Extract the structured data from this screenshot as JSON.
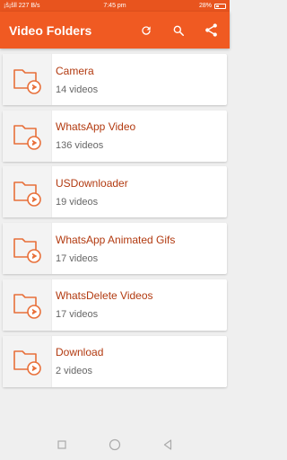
{
  "status_bar": {
    "left": "¡š¡šll 227 B/s",
    "time": "7:45 pm",
    "battery": "28%"
  },
  "app_bar": {
    "title": "Video Folders",
    "icons": [
      "refresh-icon",
      "search-icon",
      "share-icon"
    ]
  },
  "folders": [
    {
      "name": "Camera",
      "count": "14 videos"
    },
    {
      "name": "WhatsApp Video",
      "count": "136 videos"
    },
    {
      "name": "USDownloader",
      "count": "19 videos"
    },
    {
      "name": "WhatsApp Animated Gifs",
      "count": "17 videos"
    },
    {
      "name": "WhatsDelete Videos",
      "count": "17 videos"
    },
    {
      "name": "Download",
      "count": "2 videos"
    }
  ],
  "nav_bar": {
    "icons": [
      "recent-apps-icon",
      "home-icon",
      "back-icon"
    ]
  },
  "colors": {
    "accent": "#f05a22",
    "status_bar": "#e8541e",
    "folder_icon": "#e8703a",
    "folder_name": "#b23a10"
  }
}
